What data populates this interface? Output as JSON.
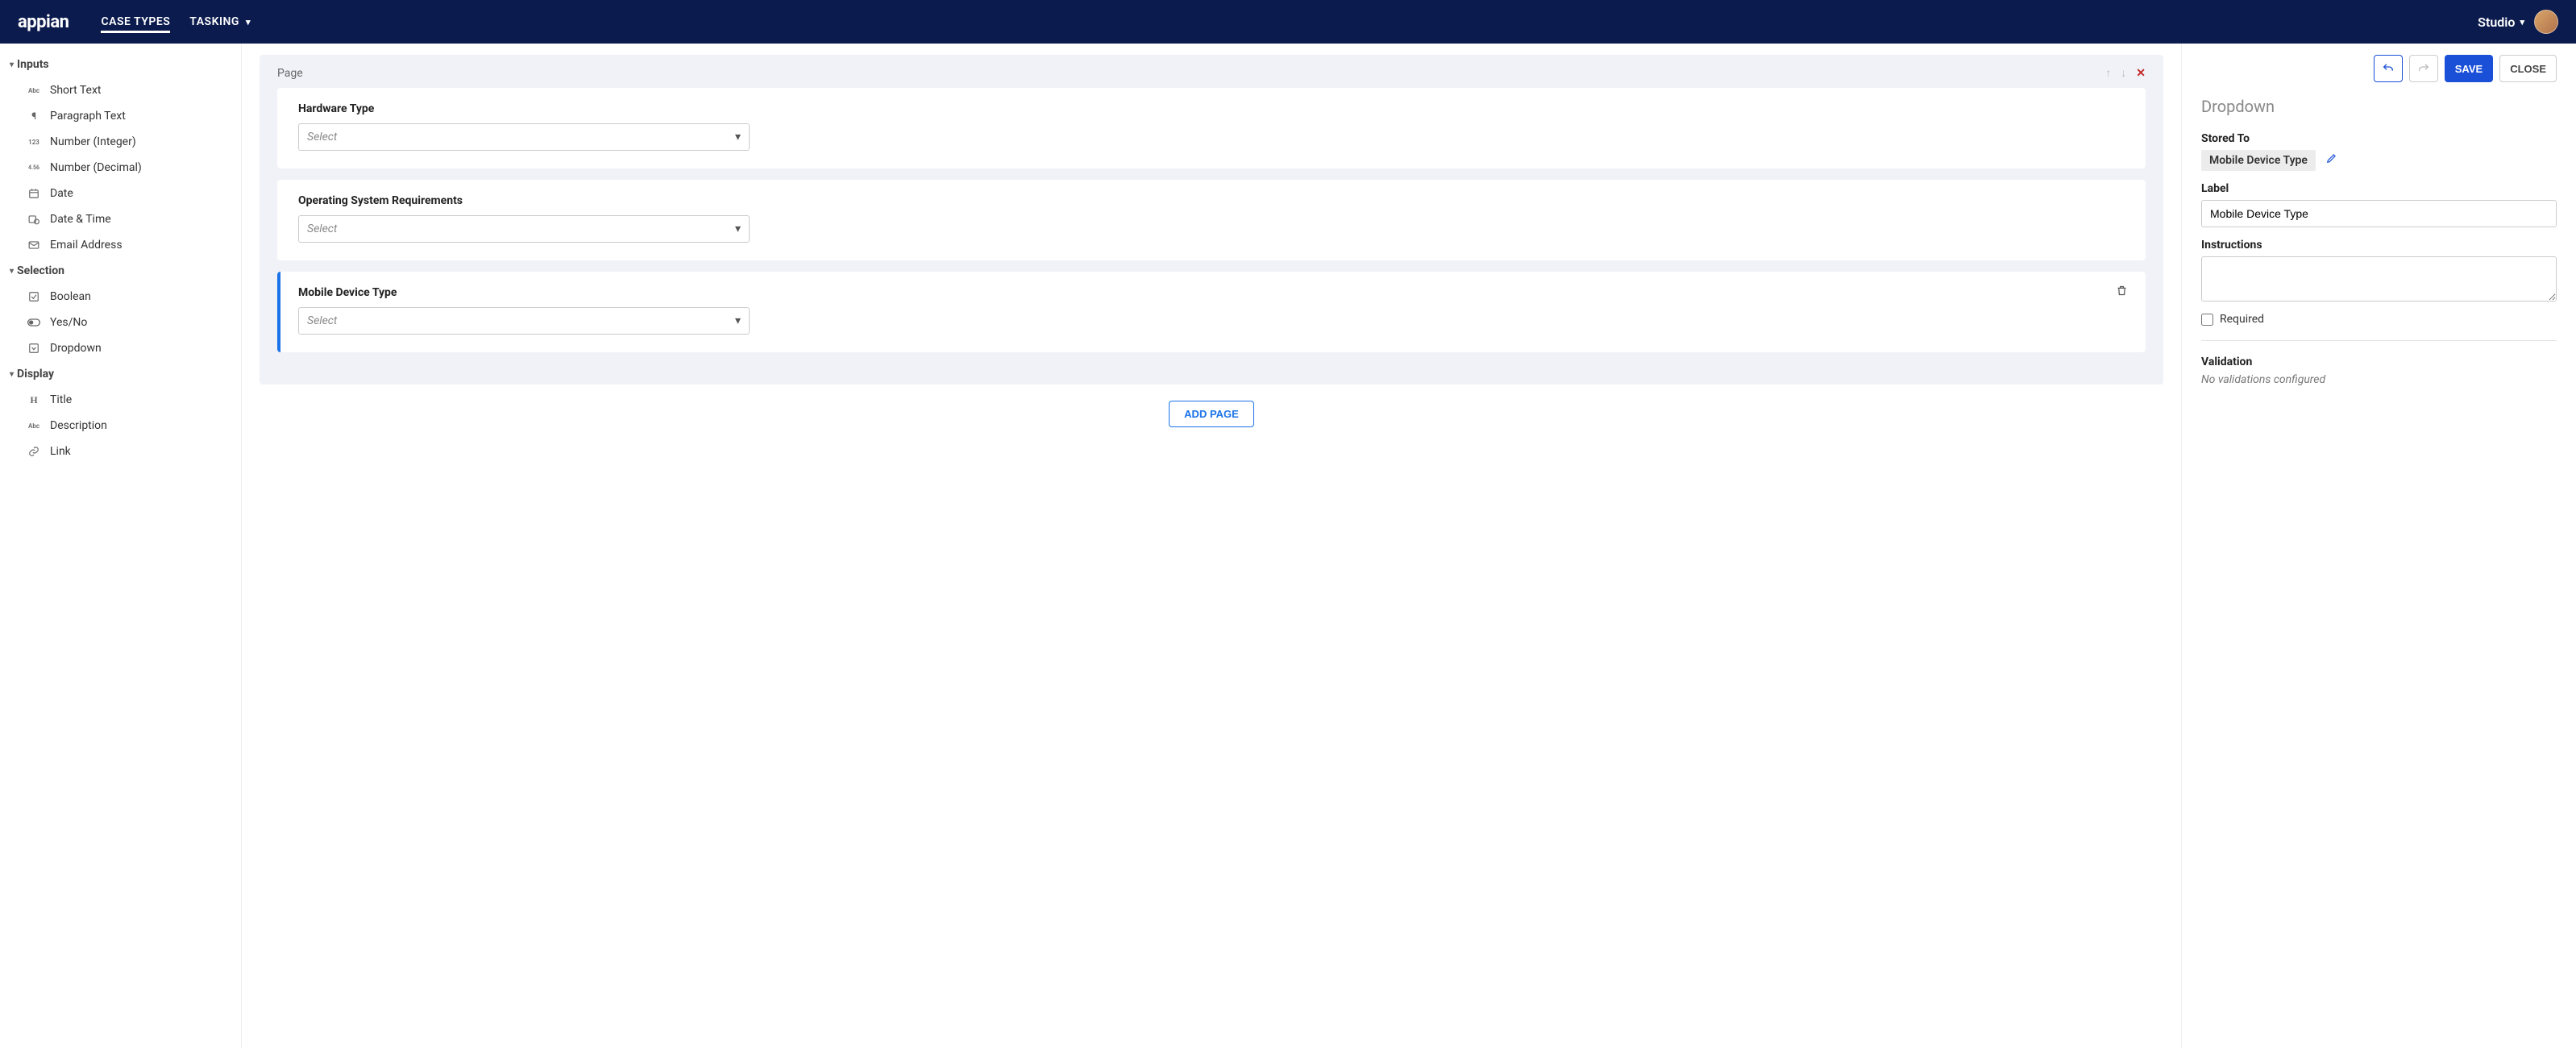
{
  "topbar": {
    "brand": "appian",
    "tabs": [
      {
        "label": "CASE TYPES",
        "active": true
      },
      {
        "label": "TASKING",
        "active": false,
        "dropdown": true
      }
    ],
    "studio_label": "Studio"
  },
  "sidebar": {
    "groups": [
      {
        "title": "Inputs",
        "items": [
          {
            "icon": "Abc",
            "label": "Short Text"
          },
          {
            "icon": "para",
            "label": "Paragraph Text"
          },
          {
            "icon": "123",
            "label": "Number (Integer)"
          },
          {
            "icon": "4.56",
            "label": "Number (Decimal)"
          },
          {
            "icon": "cal",
            "label": "Date"
          },
          {
            "icon": "calclk",
            "label": "Date & Time"
          },
          {
            "icon": "mail",
            "label": "Email Address"
          }
        ]
      },
      {
        "title": "Selection",
        "items": [
          {
            "icon": "check",
            "label": "Boolean"
          },
          {
            "icon": "toggle",
            "label": "Yes/No"
          },
          {
            "icon": "drop",
            "label": "Dropdown"
          }
        ]
      },
      {
        "title": "Display",
        "items": [
          {
            "icon": "H",
            "label": "Title"
          },
          {
            "icon": "Abc",
            "label": "Description"
          },
          {
            "icon": "link",
            "label": "Link"
          }
        ]
      }
    ]
  },
  "canvas": {
    "page_label": "Page",
    "fields": [
      {
        "label": "Hardware Type",
        "placeholder": "Select",
        "selected": false
      },
      {
        "label": "Operating System Requirements",
        "placeholder": "Select",
        "selected": false
      },
      {
        "label": "Mobile Device Type",
        "placeholder": "Select",
        "selected": true
      }
    ],
    "add_page_label": "ADD PAGE"
  },
  "details": {
    "buttons": {
      "save": "SAVE",
      "close": "CLOSE"
    },
    "title": "Dropdown",
    "stored_to_label": "Stored To",
    "stored_to_value": "Mobile Device Type",
    "label_label": "Label",
    "label_value": "Mobile Device Type",
    "instructions_label": "Instructions",
    "instructions_value": "",
    "required_label": "Required",
    "required_checked": false,
    "validation_label": "Validation",
    "validation_empty": "No validations configured"
  }
}
